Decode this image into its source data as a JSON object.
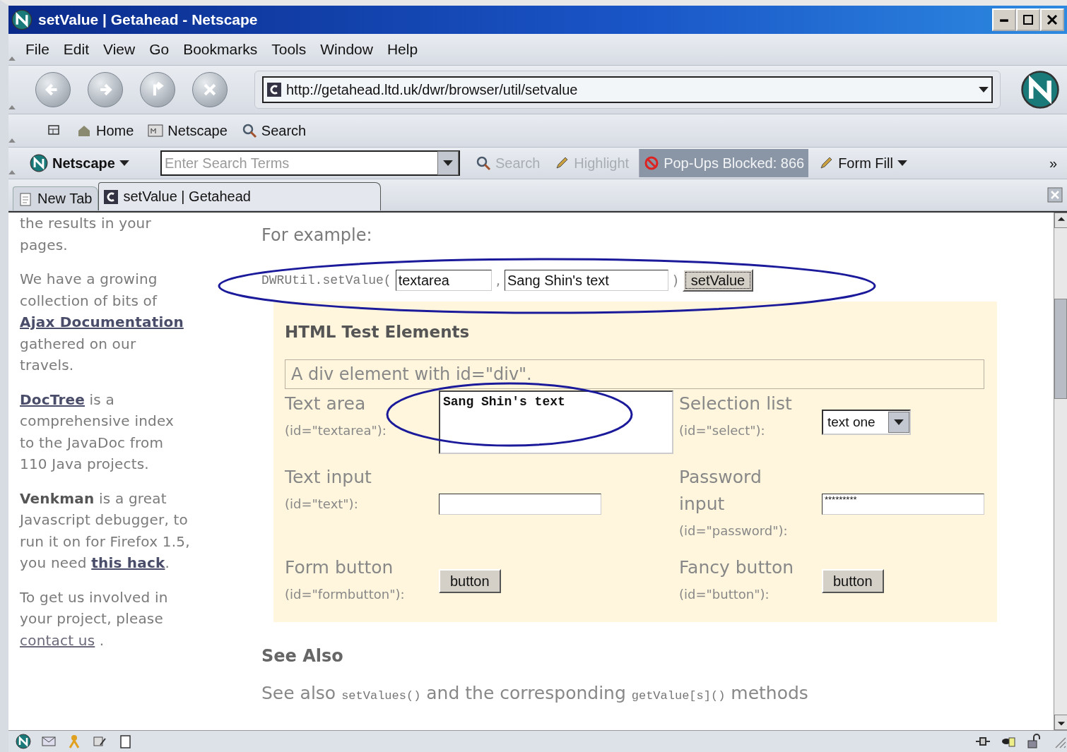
{
  "window": {
    "title": "setValue | Getahead - Netscape"
  },
  "menu": [
    "File",
    "Edit",
    "View",
    "Go",
    "Bookmarks",
    "Tools",
    "Window",
    "Help"
  ],
  "navigation": {
    "url": "http://getahead.ltd.uk/dwr/browser/util/setvalue"
  },
  "personal_toolbar": [
    "Home",
    "Netscape",
    "Search"
  ],
  "search_toolbar": {
    "engine": "Netscape",
    "placeholder": "Enter Search Terms",
    "items": [
      {
        "label": "Search",
        "kind": "disabled"
      },
      {
        "label": "Highlight",
        "kind": "disabled"
      },
      {
        "label": "Pop-Ups Blocked: 866",
        "kind": "active"
      },
      {
        "label": "Form Fill",
        "kind": "menu"
      }
    ],
    "overflow": "»"
  },
  "tabs": [
    {
      "label": "New Tab",
      "selected": false
    },
    {
      "label": "setValue | Getahead",
      "selected": true
    }
  ],
  "sidebar": {
    "paragraphs": [
      [
        {
          "kind": "text",
          "text": "the results in your pages."
        }
      ],
      [
        {
          "kind": "text",
          "text": "We have a growing collection of bits of "
        },
        {
          "kind": "link",
          "text": "Ajax Documentation"
        },
        {
          "kind": "text",
          "text": " gathered on our travels."
        }
      ],
      [
        {
          "kind": "link",
          "text": "DocTree"
        },
        {
          "kind": "text",
          "text": " is a comprehensive index to the JavaDoc from 110 Java projects."
        }
      ],
      [
        {
          "kind": "bold",
          "text": "Venkman"
        },
        {
          "kind": "text",
          "text": " is a great Javascript debugger, to run it on for Firefox 1.5, you need "
        },
        {
          "kind": "link",
          "text": "this hack"
        },
        {
          "kind": "text",
          "text": "."
        }
      ],
      [
        {
          "kind": "text",
          "text": "To get us involved in your project, please "
        },
        {
          "kind": "plainlink",
          "text": "contact us"
        },
        {
          "kind": "text",
          "text": " ."
        }
      ]
    ]
  },
  "content": {
    "intro": "For example:",
    "call": {
      "prefix": "DWRUtil.setValue(",
      "id_value": "textarea",
      "separator": ",",
      "text_value": "Sang Shin's text",
      "suffix": ")",
      "button": "setValue"
    },
    "test_panel": {
      "title": "HTML Test Elements",
      "div_text": "A div element with id=\"div\".",
      "fields": [
        {
          "kind": "textarea",
          "label": "Text area",
          "id_label": "(id=\"textarea\"):",
          "value": "Sang Shin's text"
        },
        {
          "kind": "select",
          "label": "Selection list",
          "id_label": "(id=\"select\"):",
          "value": "text one"
        },
        {
          "kind": "text",
          "label": "Text input",
          "id_label": "(id=\"text\"):"
        },
        {
          "kind": "password",
          "label": "Password input",
          "id_label": "(id=\"password\"):",
          "value": "*********"
        },
        {
          "kind": "button",
          "label": "Form button",
          "id_label": "(id=\"formbutton\"):",
          "value": "button"
        },
        {
          "kind": "button",
          "label": "Fancy button",
          "id_label": "(id=\"button\"):",
          "value": "button"
        }
      ]
    },
    "see_also": {
      "title": "See Also",
      "sentence": [
        {
          "kind": "text",
          "text": "See also "
        },
        {
          "kind": "code",
          "text": "setValues()"
        },
        {
          "kind": "text",
          "text": " and the corresponding "
        },
        {
          "kind": "code",
          "text": "getValue[s]()"
        },
        {
          "kind": "text",
          "text": " methods"
        }
      ]
    }
  }
}
